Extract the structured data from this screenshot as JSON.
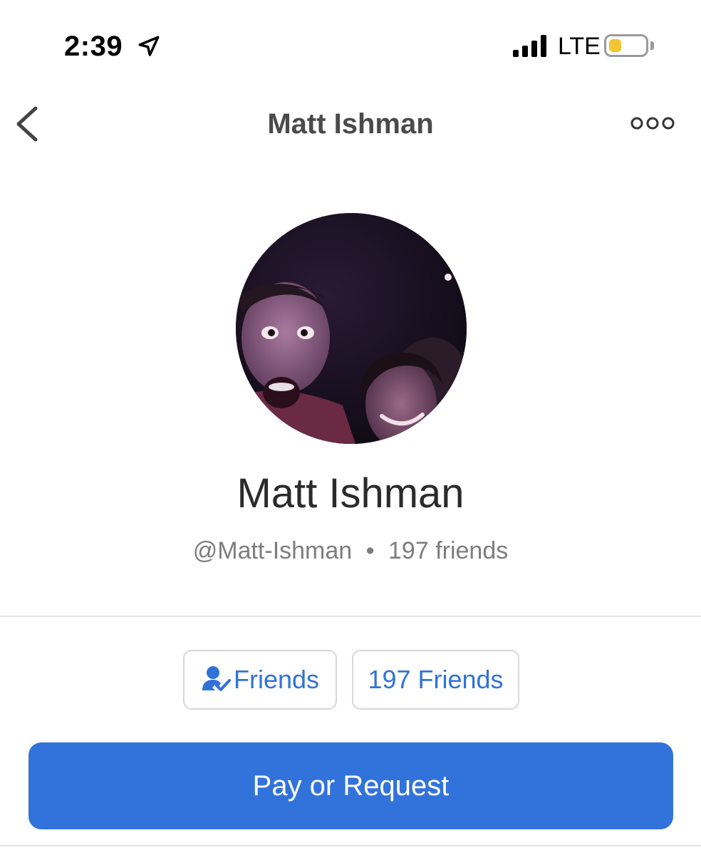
{
  "status_bar": {
    "time": "2:39",
    "network": "LTE",
    "battery_color": "#f2c531",
    "battery_level": 0.35,
    "icons": [
      "location-arrow-icon",
      "signal-bars-icon",
      "battery-icon"
    ]
  },
  "nav": {
    "title": "Matt Ishman",
    "back_icon": "chevron-left-icon",
    "more_icon": "more-options-icon"
  },
  "profile": {
    "name": "Matt Ishman",
    "username": "@Matt-Ishman",
    "separator": "•",
    "friends_count_text": "197 friends"
  },
  "actions": {
    "friends_label": "Friends",
    "friends_icon": "friend-check-icon",
    "friends_count_label": "197 Friends",
    "pay_label": "Pay or Request"
  },
  "colors": {
    "accent": "#3072d8",
    "pay_button": "#3272db",
    "text_dark": "#2b2b2b",
    "text_muted": "#7d7d7d"
  }
}
